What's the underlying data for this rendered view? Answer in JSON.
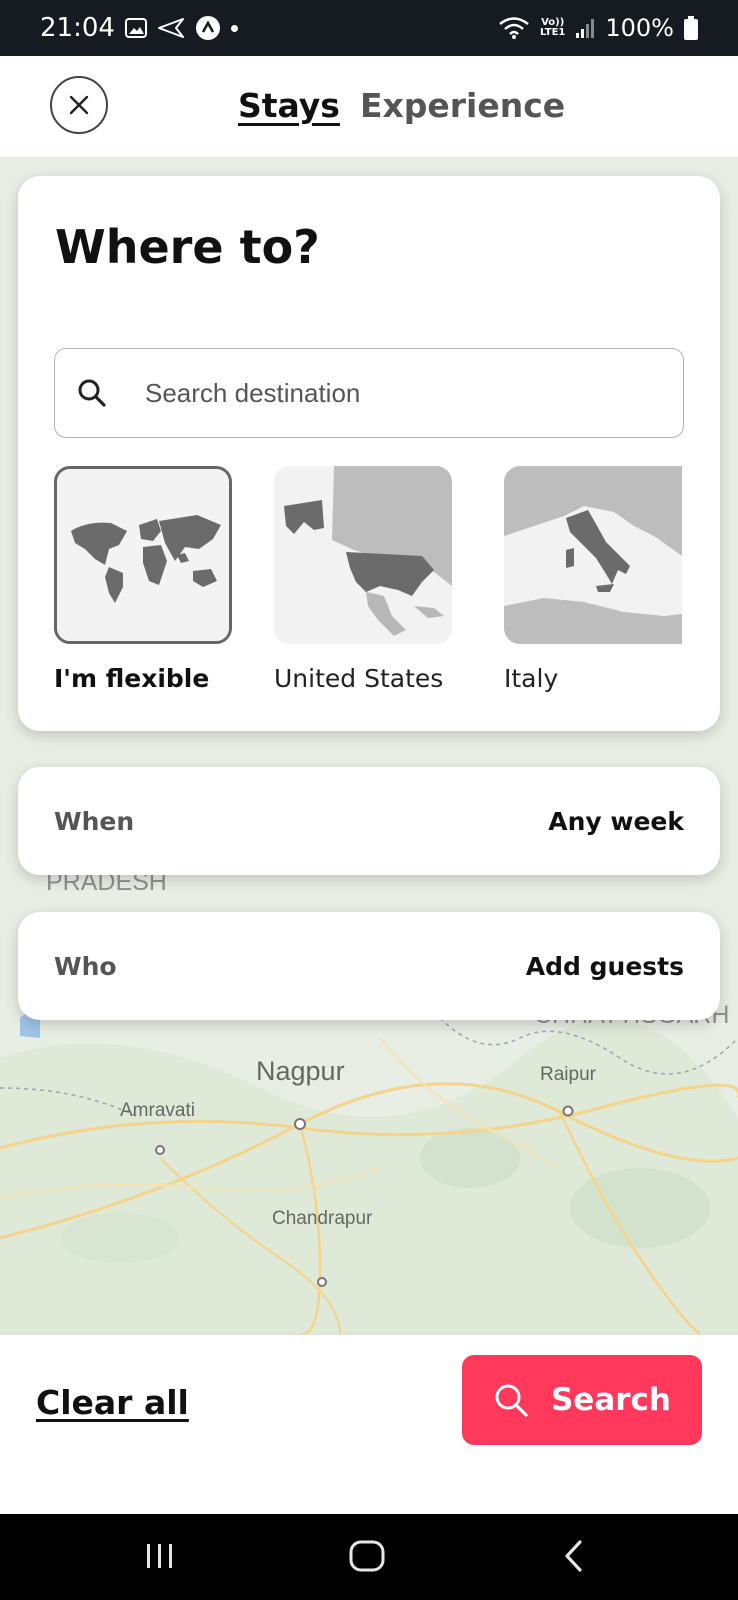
{
  "status_bar": {
    "time": "21:04",
    "lte_top": "Vo))",
    "lte_bottom": "LTE1",
    "battery": "100%",
    "icons": [
      "gallery-icon",
      "send-icon",
      "app-icon",
      "wifi-icon",
      "signal-icon",
      "battery-icon"
    ]
  },
  "header": {
    "tabs": [
      {
        "label": "Stays",
        "active": true
      },
      {
        "label": "Experience",
        "active": false
      }
    ]
  },
  "where": {
    "title": "Where to?",
    "search_placeholder": "Search destination",
    "regions": [
      {
        "label": "I'm flexible",
        "selected": true
      },
      {
        "label": "United States",
        "selected": false
      },
      {
        "label": "Italy",
        "selected": false
      }
    ]
  },
  "when": {
    "label": "When",
    "value": "Any week"
  },
  "who": {
    "label": "Who",
    "value": "Add guests"
  },
  "map_labels": {
    "pradesh": "PRADESH",
    "chhattisgarh": "CHHATTISGARH",
    "nagpur": "Nagpur",
    "raipur": "Raipur",
    "amravati": "Amravati",
    "chandrapur": "Chandrapur"
  },
  "footer": {
    "clear_all": "Clear all",
    "search": "Search"
  },
  "colors": {
    "accent": "#ff385c",
    "status_bar": "#161b22",
    "map_bg": "#e9efe6"
  }
}
